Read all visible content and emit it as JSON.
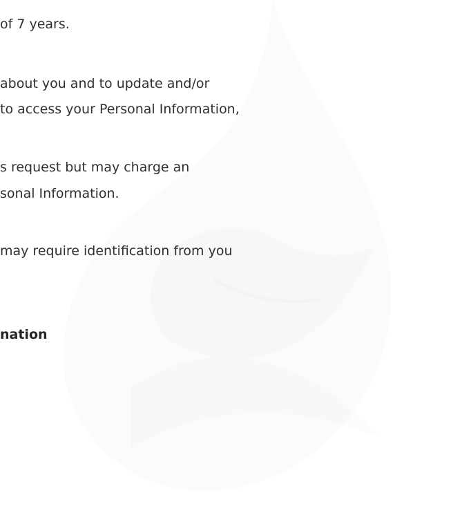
{
  "document": {
    "lines": [
      "of 7 years.",
      "about you and to update and/or",
      "to access your Personal Information,",
      "s request but may charge an",
      "sonal Information.",
      "may require identification from you",
      "nation"
    ]
  }
}
